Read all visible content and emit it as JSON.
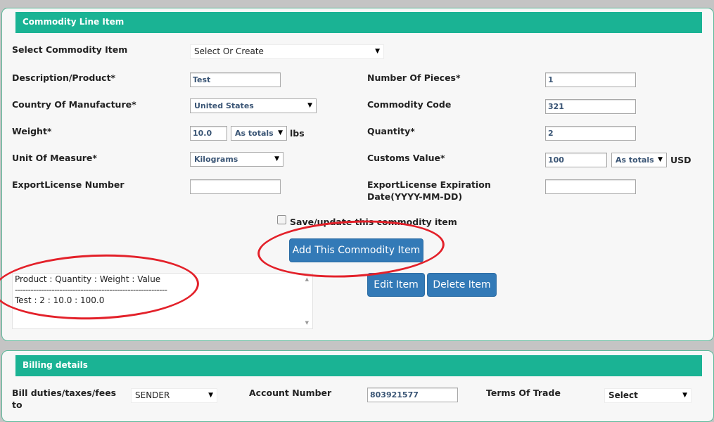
{
  "commodity": {
    "header": "Commodity Line Item",
    "select_item": {
      "label": "Select Commodity Item",
      "value": "Select Or Create"
    },
    "description": {
      "label": "Description/Product*",
      "value": "Test"
    },
    "pieces": {
      "label": "Number Of Pieces*",
      "value": "1"
    },
    "country": {
      "label": "Country Of Manufacture*",
      "value": "United States"
    },
    "code": {
      "label": "Commodity Code",
      "value": "321"
    },
    "weight": {
      "label": "Weight*",
      "value": "10.0",
      "mode": "As totals",
      "unit": "lbs"
    },
    "quantity": {
      "label": "Quantity*",
      "value": "2"
    },
    "uom": {
      "label": "Unit Of Measure*",
      "value": "Kilograms"
    },
    "customs": {
      "label": "Customs Value*",
      "value": "100",
      "mode": "As totals",
      "unit": "USD"
    },
    "export_license": {
      "label": "ExportLicense Number",
      "value": ""
    },
    "export_expiration": {
      "label_line1": "ExportLicense Expiration",
      "label_line2": "Date(YYYY-MM-DD)",
      "value": ""
    },
    "save_checkbox_label": "Save/update this commodity item",
    "add_button": "Add This Commodity Item",
    "edit_button": "Edit Item",
    "delete_button": "Delete Item",
    "summary": {
      "header": "Product : Quantity : Weight : Value",
      "divider": "----------------------------------------------------------",
      "rows": [
        "Test : 2 : 10.0 : 100.0"
      ]
    }
  },
  "billing": {
    "header": "Billing details",
    "bill_to": {
      "label_line1": "Bill duties/taxes/fees",
      "label_line2": "to",
      "value": "SENDER"
    },
    "account": {
      "label": "Account Number",
      "value": "803921577"
    },
    "terms": {
      "label": "Terms Of Trade",
      "value": "Select"
    }
  },
  "icons": {
    "dropdown": "▼",
    "scroll_up": "▲",
    "scroll_down": "▼"
  },
  "colors": {
    "header_bg": "#1ab394",
    "button_bg": "#337ab7",
    "annotation": "#e3212a"
  }
}
